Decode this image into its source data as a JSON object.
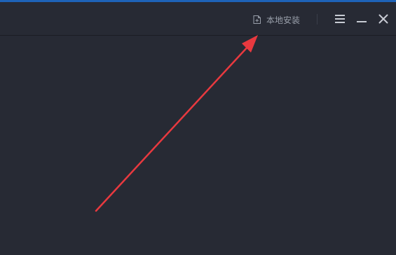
{
  "titlebar": {
    "local_install_label": "本地安装",
    "local_install_icon": "folder-plus-icon",
    "menu_icon": "hamburger-menu-icon",
    "minimize_icon": "minimize-icon",
    "close_icon": "close-icon"
  },
  "colors": {
    "background": "#272a34",
    "accent_top": "#1e63b8",
    "text_muted": "#9aa0ab",
    "arrow": "#e8393f"
  }
}
